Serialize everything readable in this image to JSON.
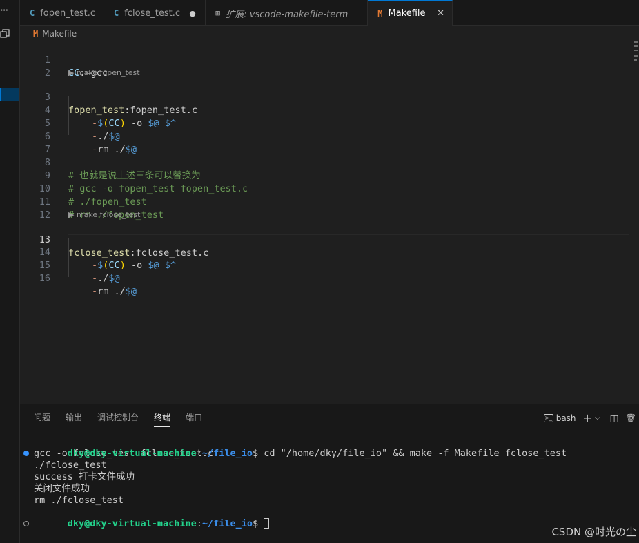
{
  "activity": {
    "more": "···"
  },
  "tabs": [
    {
      "icon": "C",
      "label": "fopen_test.c"
    },
    {
      "icon": "C",
      "label": "fclose_test.c",
      "modified_marker": "●"
    },
    {
      "icon": "⊞",
      "label": "扩展: vscode-makefile-term"
    },
    {
      "icon": "M",
      "label": "Makefile",
      "close": "✕"
    }
  ],
  "breadcrumb": {
    "icon": "M",
    "label": "Makefile"
  },
  "codelens": {
    "fopen": "▶ make fopen_test",
    "fclose": "▶ make fclose_test"
  },
  "editor": {
    "line_numbers": [
      "1",
      "2",
      "3",
      "4",
      "5",
      "6",
      "7",
      "8",
      "9",
      "10",
      "11",
      "12",
      "13",
      "14",
      "15",
      "16"
    ],
    "l1": {
      "name": "CC",
      "op": ":=",
      "value": "gcc"
    },
    "l3": {
      "target": "fopen_test",
      "colon": ":",
      "prereq": "fopen_test.c"
    },
    "l4": {
      "dash": "-",
      "d1": "$",
      "p1": "(",
      "v": "CC",
      "p2": ")",
      "mid": " -o ",
      "a1": "$@",
      "sp": " ",
      "a2": "$^"
    },
    "l5": {
      "dash": "-",
      "pre": "./",
      "a": "$@"
    },
    "l6": {
      "dash": "-",
      "pre": "rm ./",
      "a": "$@"
    },
    "l8": "# 也就是说上述三条可以替换为",
    "l9": "# gcc -o fopen_test fopen_test.c",
    "l10": "# ./fopen_test",
    "l11": "# rm ./fopen_test",
    "l13": {
      "target": "fclose_test",
      "colon": ":",
      "prereq": "fclose_test.c"
    },
    "l14": {
      "dash": "-",
      "d1": "$",
      "p1": "(",
      "v": "CC",
      "p2": ")",
      "mid": " -o ",
      "a1": "$@",
      "sp": " ",
      "a2": "$^"
    },
    "l15": {
      "dash": "-",
      "pre": "./",
      "a": "$@"
    },
    "l16": {
      "dash": "-",
      "pre": "rm ./",
      "a": "$@"
    }
  },
  "panel": {
    "tabs": [
      "问题",
      "输出",
      "调试控制台",
      "终端",
      "端口"
    ],
    "active_tab": "终端",
    "shell_icon": ">_",
    "shell": "bash",
    "add": "+",
    "chevron": "⌵",
    "split_icon": "◫",
    "trash_icon": "🗑"
  },
  "terminal": {
    "user": "dky@dky-virtual-machine",
    "colon": ":",
    "path": "~/file_io",
    "dollar": "$",
    "command": " cd \"/home/dky/file_io\" && make -f Makefile fclose_test",
    "output": [
      "gcc -o fclose_test fclose_test.c",
      "./fclose_test",
      "success 打卡文件成功",
      "关闭文件成功",
      "rm ./fclose_test"
    ]
  },
  "watermark": "CSDN @时光の尘"
}
